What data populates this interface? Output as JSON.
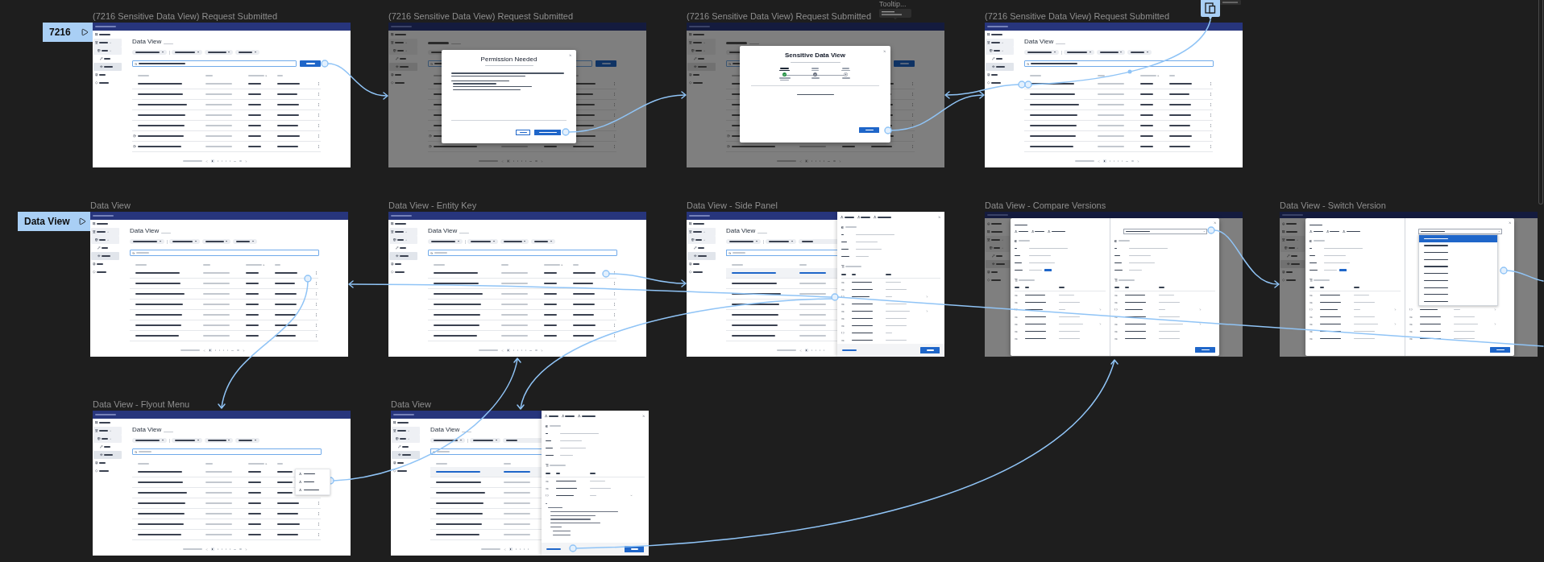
{
  "flow_starts": [
    {
      "label": "7216"
    },
    {
      "label": "Data View"
    }
  ],
  "tooltip_frame": {
    "title": "Tooltip..."
  },
  "frames": [
    {
      "title": "(7216 Sensitive Data View) Request Submitted",
      "screen": {
        "kind": "list_search",
        "page_title": "Data View"
      }
    },
    {
      "title": "(7216 Sensitive Data View) Request Submitted",
      "screen": {
        "kind": "permission",
        "dialog_title": "Permission Needed"
      }
    },
    {
      "title": "(7216 Sensitive Data View) Request Submitted",
      "screen": {
        "kind": "progress",
        "dialog_title": "Sensitive Data View"
      }
    },
    {
      "title": "(7216 Sensitive Data View) Request Submitted",
      "screen": {
        "kind": "list_result",
        "page_title": "Data View"
      }
    },
    {
      "title": "Data View",
      "screen": {
        "kind": "list",
        "page_title": "Data View"
      }
    },
    {
      "title": "Data View - Entity Key",
      "screen": {
        "kind": "list",
        "page_title": "Data View"
      }
    },
    {
      "title": "Data View - Side Panel",
      "screen": {
        "kind": "side_panel",
        "page_title": "Data View"
      }
    },
    {
      "title": "Data View - Compare Versions",
      "screen": {
        "kind": "compare"
      }
    },
    {
      "title": "Data View - Switch Version",
      "screen": {
        "kind": "switch_version"
      }
    },
    {
      "title": "Data View - Flyout Menu",
      "screen": {
        "kind": "flyout",
        "page_title": "Data View"
      }
    },
    {
      "title": "Data View",
      "screen": {
        "kind": "side_panel_json",
        "page_title": "Data View"
      }
    }
  ]
}
